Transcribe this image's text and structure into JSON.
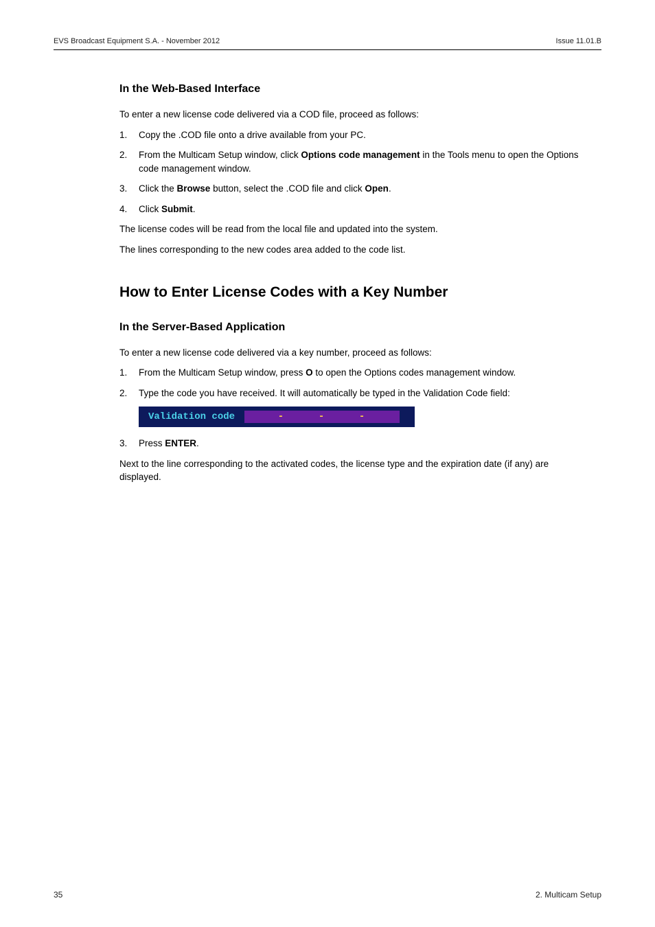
{
  "header": {
    "left": "EVS Broadcast Equipment S.A.  - November 2012",
    "right": "Issue 11.01.B"
  },
  "section_web": {
    "title": "In the Web-Based Interface",
    "intro": "To enter a new license code delivered via a COD file, proceed as follows:",
    "steps": {
      "s1": "Copy the .COD file onto a drive available from your PC.",
      "s2_a": "From the Multicam Setup window, click ",
      "s2_b": "Options code management",
      "s2_c": " in the Tools menu to open the Options code management window.",
      "s3_a": "Click the ",
      "s3_b": "Browse",
      "s3_c": " button, select the .COD file and click ",
      "s3_d": "Open",
      "s3_e": ".",
      "s4_a": "Click ",
      "s4_b": "Submit",
      "s4_c": "."
    },
    "after1": "The license codes will be read from the local file and updated into the system.",
    "after2": "The lines corresponding to the new codes area added to the code list."
  },
  "section_key": {
    "title": "How to Enter License Codes with a Key Number",
    "sub_title": "In the Server-Based Application",
    "intro": "To enter a new license code delivered via a key number, proceed as follows:",
    "steps": {
      "s1_a": "From the Multicam Setup window, press ",
      "s1_b": "O",
      "s1_c": " to open the Options codes management window.",
      "s2": "Type the code you have received. It will automatically be typed in the Validation Code field:",
      "s3_a": "Press ",
      "s3_b": "ENTER",
      "s3_c": "."
    },
    "validation_label": "Validation code",
    "dash": "-",
    "after": "Next to the line corresponding to the activated codes, the license type and the expiration date (if any) are displayed."
  },
  "footer": {
    "page": "35",
    "section": "2. Multicam Setup"
  }
}
